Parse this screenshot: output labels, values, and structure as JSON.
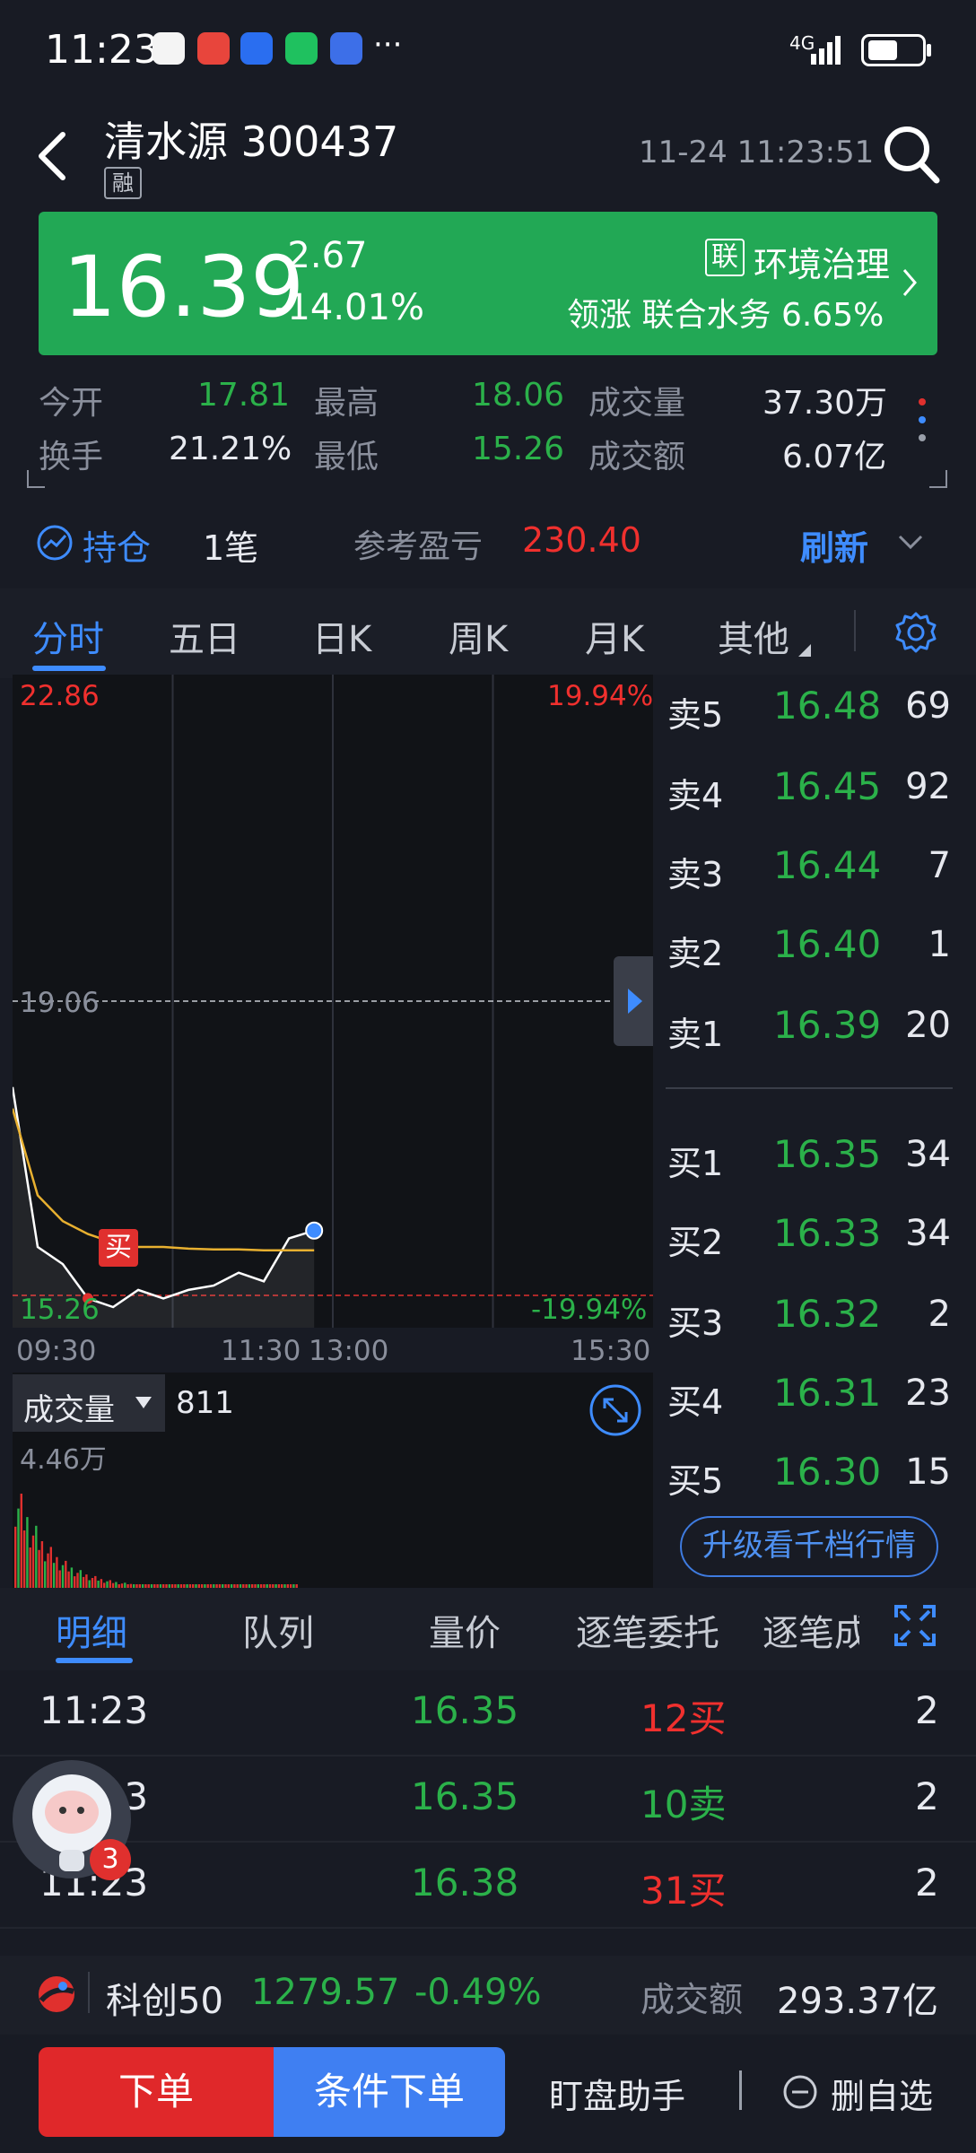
{
  "status_bar": {
    "time": "11:23",
    "network": "4G"
  },
  "header": {
    "title": "清水源 300437",
    "badge": "融",
    "datetime": "11-24 11:23:51",
    "icons": [
      "back-icon",
      "search-icon"
    ]
  },
  "quote": {
    "price": "16.39",
    "change": "-2.67",
    "change_pct": "-14.01%",
    "sector_tag": "联",
    "sector": "环境治理",
    "leader_label": "领涨",
    "leader_name": "联合水务",
    "leader_pct": "6.65%",
    "colors": {
      "card": "#22a855",
      "up": "#f0302e",
      "down": "#2bb14a"
    }
  },
  "stats": [
    {
      "label": "今开",
      "value": "17.81"
    },
    {
      "label": "最高",
      "value": "18.06"
    },
    {
      "label": "成交量",
      "value": "37.30万"
    },
    {
      "label": "换手",
      "value": "21.21%"
    },
    {
      "label": "最低",
      "value": "15.26"
    },
    {
      "label": "成交额",
      "value": "6.07亿"
    }
  ],
  "holding": {
    "label": "持仓",
    "count": "1笔",
    "pl_label": "参考盈亏",
    "pl_value": "230.40",
    "refresh": "刷新"
  },
  "chart_tabs": [
    "分时",
    "五日",
    "日K",
    "周K",
    "月K",
    "其他"
  ],
  "chart": {
    "top_price": "22.86",
    "top_pct": "19.94%",
    "mid_price": "19.06",
    "bottom_price": "15.26",
    "bottom_pct": "-19.94%",
    "times": [
      "09:30",
      "11:30",
      "13:00",
      "15:30"
    ],
    "buy_marker": "买",
    "volume_label": "成交量",
    "volume_value": "811",
    "volume_max": "4.46万"
  },
  "chart_data": {
    "type": "line",
    "title": "",
    "xlabel": "",
    "ylabel": "",
    "ylim": [
      15.26,
      22.86
    ],
    "x": [
      "09:30",
      "09:40",
      "09:50",
      "10:00",
      "10:10",
      "10:20",
      "10:30",
      "10:40",
      "10:50",
      "11:00",
      "11:10",
      "11:20",
      "11:23"
    ],
    "series": [
      {
        "values": [
          18.06,
          16.2,
          16.0,
          15.6,
          15.5,
          15.7,
          15.6,
          15.7,
          15.75,
          15.9,
          15.8,
          16.3,
          16.39
        ]
      },
      {
        "values": [
          17.81,
          16.8,
          16.5,
          16.35,
          16.25,
          16.2,
          16.2,
          16.18,
          16.17,
          16.17,
          16.16,
          16.16,
          16.16
        ]
      }
    ]
  },
  "order_book": {
    "asks": [
      {
        "label": "卖5",
        "price": "16.48",
        "vol": "69"
      },
      {
        "label": "卖4",
        "price": "16.45",
        "vol": "92"
      },
      {
        "label": "卖3",
        "price": "16.44",
        "vol": "7"
      },
      {
        "label": "卖2",
        "price": "16.40",
        "vol": "1"
      },
      {
        "label": "卖1",
        "price": "16.39",
        "vol": "20"
      }
    ],
    "bids": [
      {
        "label": "买1",
        "price": "16.35",
        "vol": "34"
      },
      {
        "label": "买2",
        "price": "16.33",
        "vol": "34"
      },
      {
        "label": "买3",
        "price": "16.32",
        "vol": "2"
      },
      {
        "label": "买4",
        "price": "16.31",
        "vol": "23"
      },
      {
        "label": "买5",
        "price": "16.30",
        "vol": "15"
      }
    ],
    "upgrade": "升级看千档行情"
  },
  "detail_tabs": [
    "明细",
    "队列",
    "量价",
    "逐笔委托",
    "逐笔成"
  ],
  "trades": [
    {
      "time": "11:23",
      "price": "16.35",
      "qty": "12买",
      "n": "2"
    },
    {
      "time": "11:23",
      "price": "16.35",
      "qty": "10卖",
      "n": "2"
    },
    {
      "time": "11:23",
      "price": "16.38",
      "qty": "31买",
      "n": "2"
    }
  ],
  "assistant_badge": "3",
  "index_bar": {
    "name": "科创50",
    "value": "1279.57",
    "change": "-0.49%",
    "turnover_label": "成交额",
    "turnover": "293.37亿"
  },
  "bottom": {
    "order": "下单",
    "conditional": "条件下单",
    "assistant": "盯盘助手",
    "remove_fav": "删自选"
  }
}
